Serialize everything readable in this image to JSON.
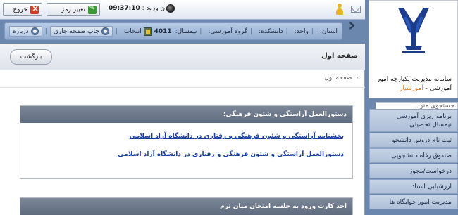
{
  "topbar": {
    "exit_label": "خروج",
    "change_password_label": "تغییر رمز",
    "login_time_label": "زمان ورود :",
    "login_time_value": "09:37:10"
  },
  "infobar": {
    "province_label": "استان:",
    "unit_label": "واحد:",
    "faculty_label": "دانشکده:",
    "group_label": "گروه آموزشی:",
    "semester_label": "نیمسال:",
    "semester_value": "4011",
    "select_label": "انتخاب",
    "print_label": "چاپ صفحه جاری",
    "about_label": "درباره"
  },
  "main": {
    "page_title": "صفحه اول",
    "back_label": "بازگشت",
    "breadcrumb": "صفحه اول",
    "box1_title": "دستورالعمل آراستگی و شئون فرهنگی:",
    "box1_links": [
      "بخشنامه آراستگی و شئون فرهنگی و رفتاری در دانشگاه آزاد اسلامی",
      "دستورالعمل آراستگی و شئون فرهنگی و رفتاری در دانشگاه آزاد اسلامی"
    ],
    "box2_title": "اخذ کارت ورود به جلسه امتحان میان ترم"
  },
  "sidebar": {
    "system_title_line1": "سامانه مدیریت یکپارچه امور",
    "system_title_line2": "آموزشی - ",
    "system_title_accent": "آموزشیار",
    "search_placeholder": "جستجوی منو...",
    "menu": [
      {
        "label_line1": "برنامه ریزی آموزشی",
        "label_line2": "نیمسال تحصیلی"
      },
      {
        "label_line1": "ثبت نام دروس دانشجو"
      },
      {
        "label_line1": "صندوق رفاه دانشجویی"
      },
      {
        "label_line1": "درخواست/مجوز"
      },
      {
        "label_line1": "ارزشیابی استاد"
      },
      {
        "label_line1": "مدیریت امور خوابگاه ها"
      }
    ]
  },
  "colors": {
    "accent": "#e0801f",
    "header_box": "#6b7689",
    "link": "#1a3fa2",
    "sidebar_bg": "#6b87ad"
  }
}
